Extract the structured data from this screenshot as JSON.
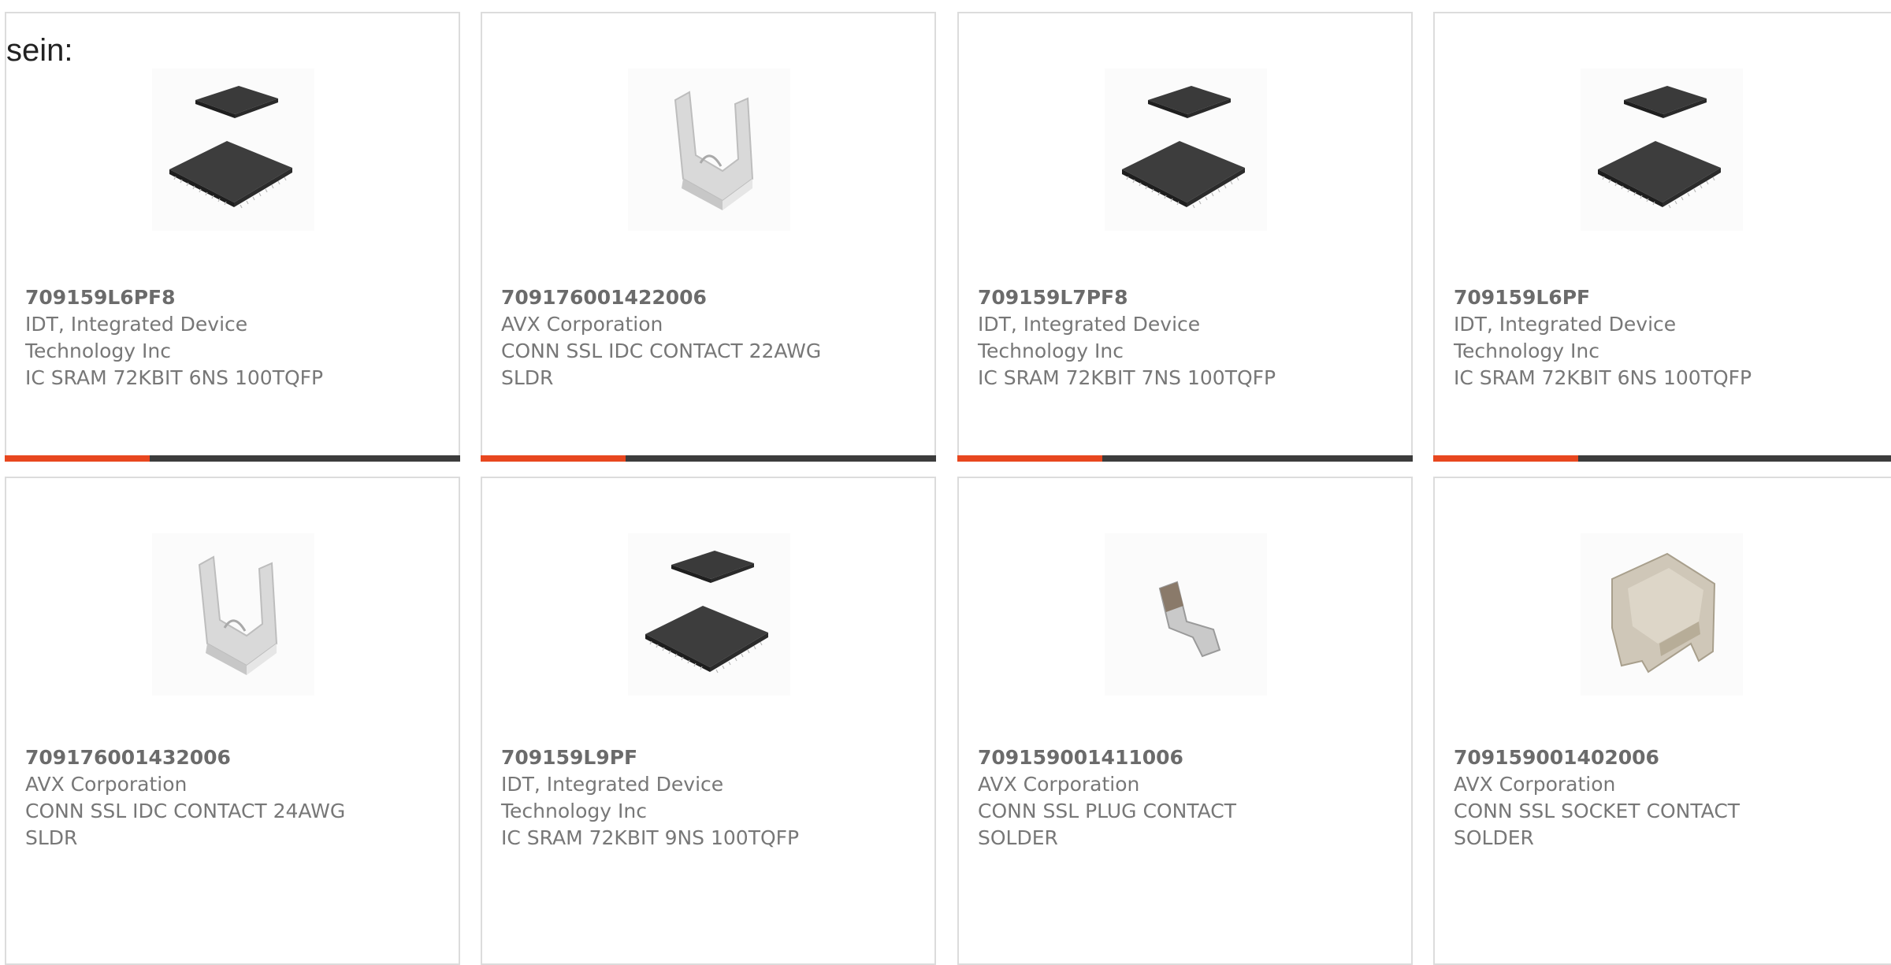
{
  "intro_text": "sein:",
  "colors": {
    "accent": "#e8471f",
    "bar": "#3c3c3c",
    "border": "#dcdcdc",
    "text": "#777777"
  },
  "products": [
    {
      "part_number": "709159L6PF8",
      "manufacturer_line1": "IDT, Integrated Device",
      "manufacturer_line2": "Technology Inc",
      "desc_line1": "IC SRAM 72KBIT 6NS 100TQFP",
      "desc_line2": "",
      "image": "tqfp-chip-icon"
    },
    {
      "part_number": "709176001422006",
      "manufacturer_line1": "AVX Corporation",
      "manufacturer_line2": "",
      "desc_line1": "CONN SSL IDC CONTACT 22AWG",
      "desc_line2": "SLDR",
      "image": "idc-contact-icon"
    },
    {
      "part_number": "709159L7PF8",
      "manufacturer_line1": "IDT, Integrated Device",
      "manufacturer_line2": "Technology Inc",
      "desc_line1": "IC SRAM 72KBIT 7NS 100TQFP",
      "desc_line2": "",
      "image": "tqfp-chip-icon"
    },
    {
      "part_number": "709159L6PF",
      "manufacturer_line1": "IDT, Integrated Device",
      "manufacturer_line2": "Technology Inc",
      "desc_line1": "IC SRAM 72KBIT 6NS 100TQFP",
      "desc_line2": "",
      "image": "tqfp-chip-icon"
    },
    {
      "part_number": "709176001432006",
      "manufacturer_line1": "AVX Corporation",
      "manufacturer_line2": "",
      "desc_line1": "CONN SSL IDC CONTACT 24AWG",
      "desc_line2": "SLDR",
      "image": "idc-contact-icon"
    },
    {
      "part_number": "709159L9PF",
      "manufacturer_line1": "IDT, Integrated Device",
      "manufacturer_line2": "Technology Inc",
      "desc_line1": "IC SRAM 72KBIT 9NS 100TQFP",
      "desc_line2": "",
      "image": "tqfp-chip-icon"
    },
    {
      "part_number": "709159001411006",
      "manufacturer_line1": "AVX Corporation",
      "manufacturer_line2": "",
      "desc_line1": "CONN SSL PLUG CONTACT",
      "desc_line2": "SOLDER",
      "image": "plug-contact-icon"
    },
    {
      "part_number": "709159001402006",
      "manufacturer_line1": "AVX Corporation",
      "manufacturer_line2": "",
      "desc_line1": "CONN SSL SOCKET CONTACT",
      "desc_line2": "SOLDER",
      "image": "socket-contact-icon"
    }
  ]
}
